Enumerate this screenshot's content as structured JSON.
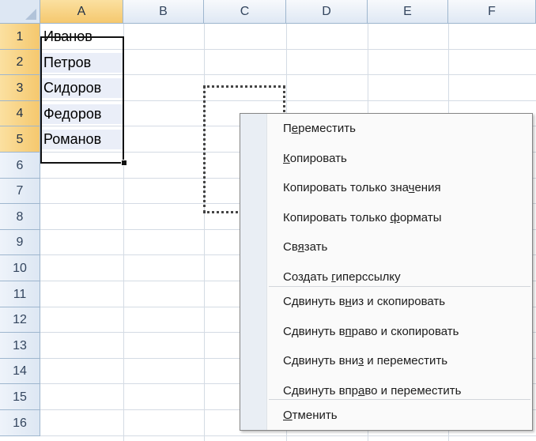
{
  "columns": [
    "A",
    "B",
    "C",
    "D",
    "E",
    "F"
  ],
  "rows": [
    "1",
    "2",
    "3",
    "4",
    "5",
    "6",
    "7",
    "8",
    "9",
    "10",
    "11",
    "12",
    "13",
    "14",
    "15",
    "16"
  ],
  "cells": [
    "Иванов",
    "Петров",
    "Сидоров",
    "Федоров",
    "Романов"
  ],
  "context_menu": {
    "group1": [
      {
        "prefix": "П",
        "accel": "е",
        "suffix": "реместить"
      },
      {
        "prefix": "",
        "accel": "К",
        "suffix": "опировать"
      },
      {
        "prefix": "Копировать только зна",
        "accel": "ч",
        "suffix": "ения"
      },
      {
        "prefix": "Копировать только ",
        "accel": "ф",
        "suffix": "орматы"
      },
      {
        "prefix": "Св",
        "accel": "я",
        "suffix": "зать"
      },
      {
        "prefix": "Создать ",
        "accel": "г",
        "suffix": "иперссылку"
      }
    ],
    "group2": [
      {
        "prefix": "Сдвинуть в",
        "accel": "н",
        "suffix": "из и скопировать"
      },
      {
        "prefix": "Сдвинуть в",
        "accel": "п",
        "suffix": "раво и скопировать"
      },
      {
        "prefix": "Сдвинуть вни",
        "accel": "з",
        "suffix": " и переместить"
      },
      {
        "prefix": "Сдвинуть впр",
        "accel": "а",
        "suffix": "во и переместить"
      }
    ],
    "group3": [
      {
        "prefix": "",
        "accel": "О",
        "suffix": "тменить"
      }
    ]
  },
  "colors": {
    "header_selected": "#f5c86e",
    "header_normal": "#dfe8f4",
    "selection_fill": "#eaeef8",
    "gridline": "#d4dbe4"
  }
}
